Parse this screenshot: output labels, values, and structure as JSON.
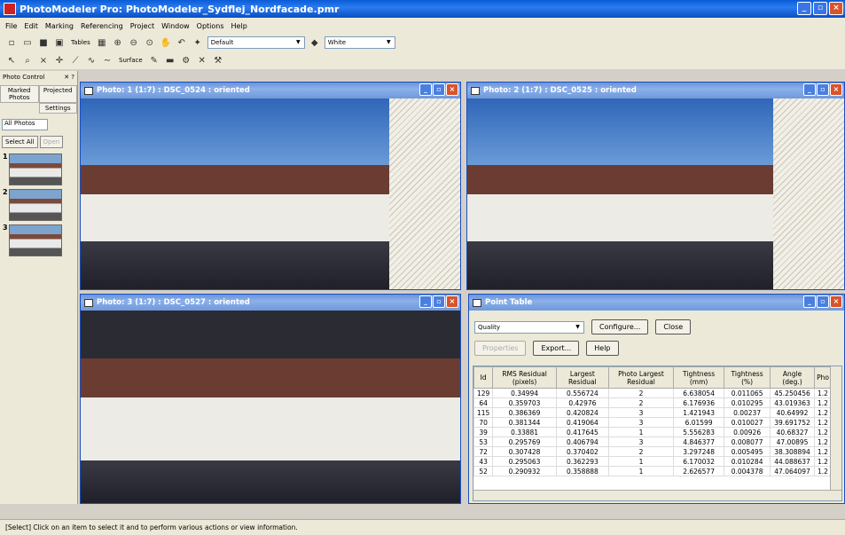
{
  "window": {
    "title": "PhotoModeler Pro: PhotoModeler_Sydflej_Nordfacade.pmr"
  },
  "menu": [
    "File",
    "Edit",
    "Marking",
    "Referencing",
    "Project",
    "Window",
    "Options",
    "Help"
  ],
  "toolbar1": {
    "tables_label": "Tables",
    "default_combo": "Default",
    "white_combo": "White"
  },
  "toolbar2": {
    "surface_label": "Surface"
  },
  "sidepanel": {
    "title": "Photo Control",
    "tabs": [
      "Marked Photos",
      "Projected",
      "Settings"
    ],
    "filter": "All Photos",
    "select_all": "Select All",
    "open": "Open",
    "thumbs": [
      "1",
      "2",
      "3"
    ]
  },
  "photos": [
    {
      "title": "Photo: 1 (1:7) : DSC_0524 : oriented"
    },
    {
      "title": "Photo: 2 (1:7) : DSC_0525 : oriented"
    },
    {
      "title": "Photo: 3 (1:7) : DSC_0527 : oriented"
    }
  ],
  "point_table": {
    "title": "Point Table",
    "quality": "Quality",
    "configure": "Configure...",
    "close": "Close",
    "properties": "Properties",
    "export": "Export...",
    "help": "Help",
    "columns": [
      "Id",
      "RMS Residual (pixels)",
      "Largest Residual",
      "Photo Largest Residual",
      "Tightness (mm)",
      "Tightness (%)",
      "Angle (deg.)",
      "Pho"
    ],
    "rows": [
      [
        "129",
        "0.34994",
        "0.556724",
        "2",
        "6.638054",
        "0.011065",
        "45.250456",
        "1.2"
      ],
      [
        "64",
        "0.359703",
        "0.42976",
        "2",
        "6.176936",
        "0.010295",
        "43.019363",
        "1.2"
      ],
      [
        "115",
        "0.386369",
        "0.420824",
        "3",
        "1.421943",
        "0.00237",
        "40.64992",
        "1.2"
      ],
      [
        "70",
        "0.381344",
        "0.419064",
        "3",
        "6.01599",
        "0.010027",
        "39.691752",
        "1.2"
      ],
      [
        "39",
        "0.33881",
        "0.417645",
        "1",
        "5.556283",
        "0.00926",
        "40.68327",
        "1.2"
      ],
      [
        "53",
        "0.295769",
        "0.406794",
        "3",
        "4.846377",
        "0.008077",
        "47.00895",
        "1.2"
      ],
      [
        "72",
        "0.307428",
        "0.370402",
        "2",
        "3.297248",
        "0.005495",
        "38.308894",
        "1.2"
      ],
      [
        "43",
        "0.295063",
        "0.362293",
        "1",
        "6.170032",
        "0.010284",
        "44.088637",
        "1.2"
      ],
      [
        "52",
        "0.290932",
        "0.358888",
        "1",
        "2.626577",
        "0.004378",
        "47.064097",
        "1.2"
      ]
    ]
  },
  "status": "[Select] Click on an item to select it and to perform various actions or view information."
}
